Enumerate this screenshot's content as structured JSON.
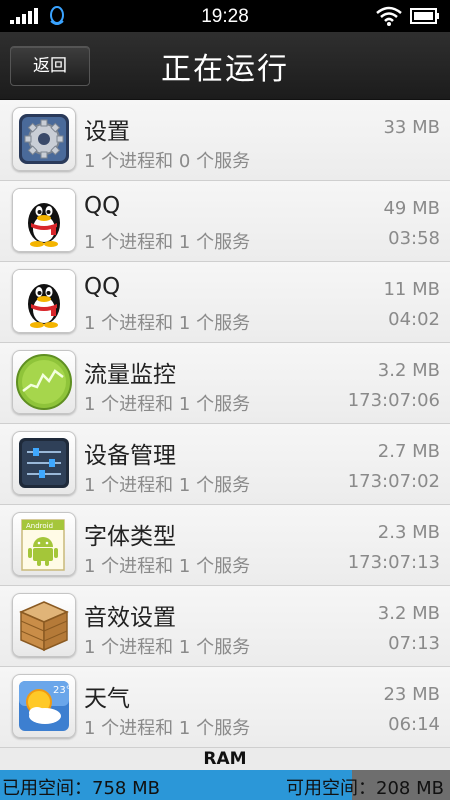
{
  "status_bar": {
    "time": "19:28",
    "icons": [
      "signal-icon",
      "qq-tray-icon",
      "wifi-icon",
      "battery-icon"
    ]
  },
  "header": {
    "back_label": "返回",
    "title": "正在运行"
  },
  "processes": [
    {
      "icon": "settings-gear-icon",
      "name": "设置",
      "desc": "1 个进程和 0 个服务",
      "memory": "33 MB",
      "time": ""
    },
    {
      "icon": "qq-penguin-icon",
      "name": "QQ",
      "desc": "1 个进程和 1 个服务",
      "memory": "49 MB",
      "time": "03:58"
    },
    {
      "icon": "qq-penguin-icon",
      "name": "QQ",
      "desc": "1 个进程和 1 个服务",
      "memory": "11 MB",
      "time": "04:02"
    },
    {
      "icon": "traffic-monitor-icon",
      "name": "流量监控",
      "desc": "1 个进程和 1 个服务",
      "memory": "3.2 MB",
      "time": "173:07:06"
    },
    {
      "icon": "device-manager-sliders-icon",
      "name": "设备管理",
      "desc": "1 个进程和 1 个服务",
      "memory": "2.7 MB",
      "time": "173:07:02"
    },
    {
      "icon": "android-font-icon",
      "name": "字体类型",
      "desc": "1 个进程和 1 个服务",
      "memory": "2.3 MB",
      "time": "173:07:13"
    },
    {
      "icon": "wooden-crate-icon",
      "name": "音效设置",
      "desc": "1 个进程和 1 个服务",
      "memory": "3.2 MB",
      "time": "07:13"
    },
    {
      "icon": "weather-sun-cloud-icon",
      "name": "天气",
      "desc": "1 个进程和 1 个服务",
      "memory": "23 MB",
      "time": "06:14"
    }
  ],
  "ram": {
    "label": "RAM",
    "used_text": "已用空间：758 MB",
    "free_text": "可用空间：208 MB",
    "used_fraction": 0.782,
    "used_color": "#2b97d8",
    "free_color": "#6e6e6e"
  }
}
